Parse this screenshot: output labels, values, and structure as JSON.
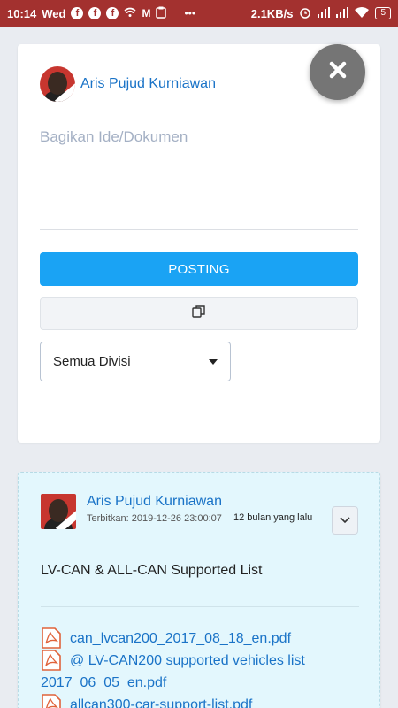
{
  "status_bar": {
    "time": "10:14",
    "day": "Wed",
    "net_speed": "2.1KB/s",
    "battery": "5"
  },
  "composer": {
    "author": "Aris Pujud Kurniawan",
    "placeholder": "Bagikan Ide/Dokumen",
    "post_button": "POSTING",
    "division_select": "Semua Divisi"
  },
  "post": {
    "author": "Aris Pujud Kurniawan",
    "published": "Terbitkan: 2019-12-26 23:00:07",
    "relative_time": "12 bulan yang lalu",
    "title": "LV-CAN & ALL-CAN Supported List",
    "attachments": [
      "can_lvcan200_2017_08_18_en.pdf",
      "@ LV-CAN200 supported vehicles list 2017_06_05_en.pdf",
      "allcan300-car-support-list.pdf"
    ]
  },
  "colors": {
    "status_bar": "#a3312f",
    "accent": "#1aa3f4",
    "link": "#1a73c7",
    "post_bg": "#e3f7fd",
    "pdf_icon": "#e0633b"
  },
  "icons": [
    "facebook-icon",
    "wifi-icon",
    "gmail-icon",
    "alarm-icon",
    "signal-icon",
    "close-icon",
    "copy-icon",
    "chevron-down-icon",
    "pdf-icon"
  ]
}
